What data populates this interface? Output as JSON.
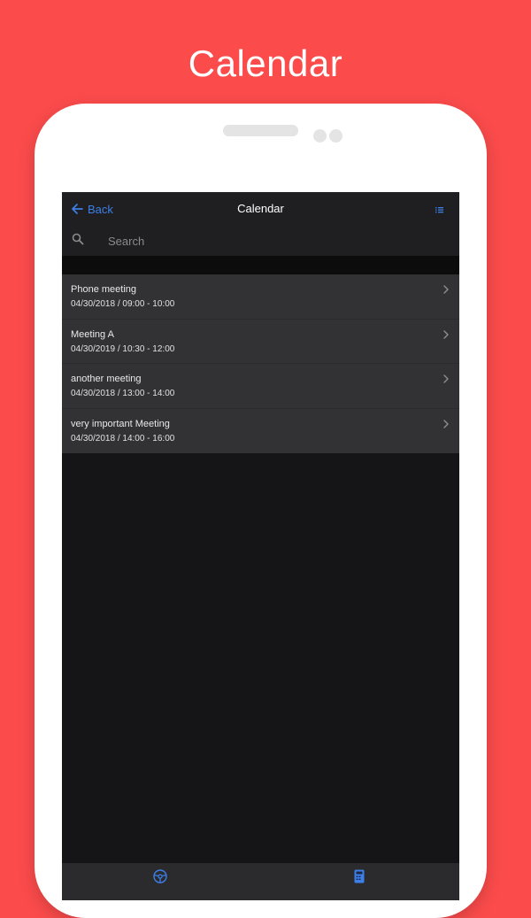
{
  "promo": {
    "title": "Calendar"
  },
  "navbar": {
    "back_label": "Back",
    "title": "Calendar",
    "back_icon": "arrow-left-icon",
    "menu_icon": "list-icon"
  },
  "search": {
    "placeholder": "Search",
    "value": "",
    "icon": "search-icon"
  },
  "meetings": [
    {
      "title": "Phone meeting",
      "when": "04/30/2018 / 09:00 - 10:00"
    },
    {
      "title": "Meeting A",
      "when": "04/30/2019 / 10:30 - 12:00"
    },
    {
      "title": "another meeting",
      "when": "04/30/2018 / 13:00 - 14:00"
    },
    {
      "title": "very important Meeting",
      "when": "04/30/2018 / 14:00 - 16:00"
    }
  ],
  "tabbar": {
    "tabs": [
      {
        "icon": "steering-wheel-icon"
      },
      {
        "icon": "calculator-icon"
      }
    ]
  },
  "colors": {
    "background": "#fb4b4b",
    "accent": "#3d7fe8",
    "screen": "#151417",
    "list_row": "#323234"
  }
}
